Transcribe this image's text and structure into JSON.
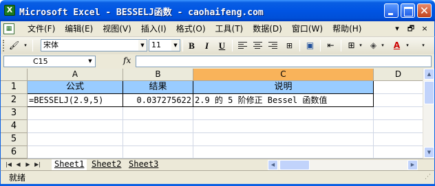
{
  "window": {
    "title": "Microsoft Excel - BESSELJ函数 - caohaifeng.com",
    "app_icon": "X"
  },
  "menu": {
    "items": [
      "文件(F)",
      "编辑(E)",
      "视图(V)",
      "插入(I)",
      "格式(O)",
      "工具(T)",
      "数据(D)",
      "窗口(W)",
      "帮助(H)"
    ],
    "help_search_arrow": "▾",
    "restore": "🗗",
    "close": "×"
  },
  "toolbar": {
    "font_name": "宋体",
    "font_size": "11",
    "bold": "B",
    "italic": "I",
    "underline": "U"
  },
  "formula_bar": {
    "name_box": "C15",
    "fx": "fx",
    "formula": ""
  },
  "grid": {
    "columns": [
      "A",
      "B",
      "C",
      "D"
    ],
    "active_column": "C",
    "rows": [
      "1",
      "2",
      "3",
      "4",
      "5",
      "6"
    ],
    "header_row": {
      "a": "公式",
      "b": "结果",
      "c": "说明"
    },
    "data_row": {
      "a": "=BESSELJ(2.9,5)",
      "b": "0.037275622",
      "c": "2.9 的 5 阶修正 Bessel 函数值"
    }
  },
  "sheets": {
    "tabs": [
      "Sheet1",
      "Sheet2",
      "Sheet3"
    ],
    "active": "Sheet1"
  },
  "status": {
    "text": "就绪"
  },
  "colors": {
    "titlebar": "#0054e3",
    "header_fill": "#99ccff",
    "active_column_header": "#f9b35a",
    "chrome": "#ece9d8"
  }
}
